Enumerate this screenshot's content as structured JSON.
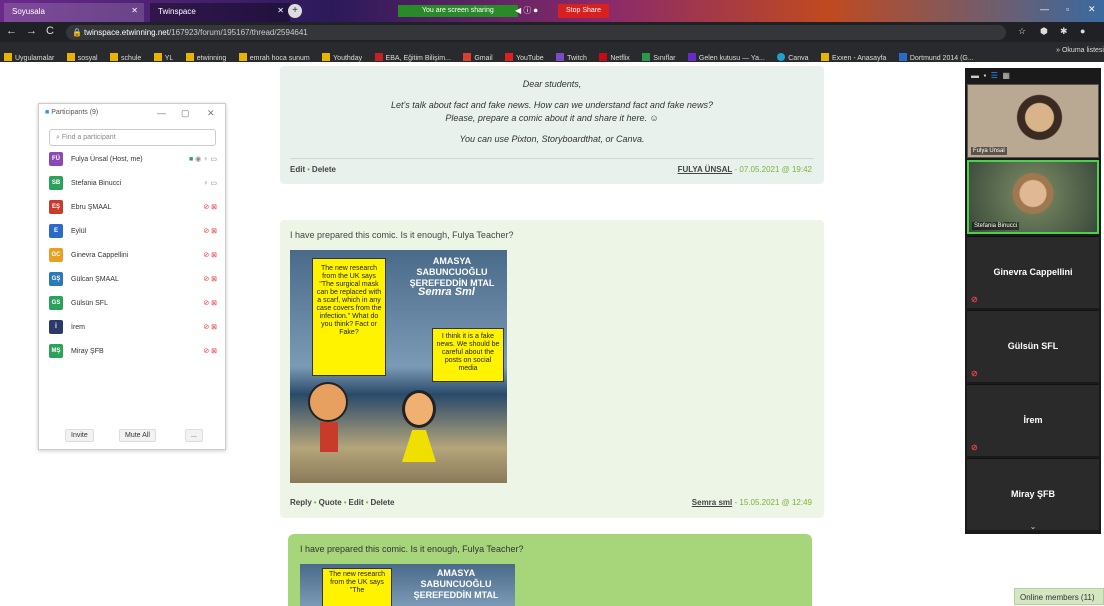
{
  "browser": {
    "tabs": [
      {
        "label": "Soyusala"
      },
      {
        "label": "Twinspace"
      }
    ],
    "new_tab": "+",
    "screen_share": {
      "label": "You are screen sharing",
      "stop_label": "Stop Share"
    },
    "url_domain": "twinspace.etwinning.net",
    "url_path": "/167923/forum/195167/thread/2594641",
    "bookmarks": [
      "Uygulamalar",
      "sosyal",
      "schule",
      "YL",
      "etwinning",
      "emrah hoca sunum",
      "Youthday",
      "EBA, Eğitim Bilişim...",
      "Gmail",
      "YouTube",
      "Twitch",
      "Netflix",
      "Sınıflar",
      "Gelen kutusu — Ya...",
      "Canva",
      "Exxen - Anasayfa",
      "Dortmund 2014 (G..."
    ],
    "bookmarks_more": "» Okuma listesi"
  },
  "post1": {
    "greeting": "Dear students,",
    "line1": "Let's talk about fact and fake news. How can we understand fact and fake news?",
    "line2": "Please, prepare a comic about it and share it here. ☺",
    "line3": "You can use Pixton, Storyboardthat, or Canva.",
    "edit": "Edit",
    "delete": "Delete",
    "author": "FULYA ÜNSAL",
    "date": "- 07.05.2021 @ 19:42"
  },
  "post2": {
    "text": "I have prepared this comic. Is it enough, Fulya Teacher?",
    "reply": "Reply",
    "quote": "Quote",
    "edit": "Edit",
    "delete": "Delete",
    "author": "Semra sml",
    "date": "- 15.05.2021 @ 12:49",
    "comic": {
      "title": "AMASYA SABUNCUOĞLU ŞEREFEDDİN MTAL",
      "signature": "Semra Sml",
      "bubble1": "The new research from the UK says \"The surgical mask can be replaced with a scarf, which in any case covers from the infection.\" What do you think? Fact or Fake?",
      "bubble2": "I think it is a fake news. We should be careful about the posts on social media"
    }
  },
  "post3": {
    "text": "I have prepared this comic. Is it enough, Fulya Teacher?",
    "comic_title": "AMASYA SABUNCUOĞLU ŞEREFEDDİN MTAL",
    "bubble": "The new research from the UK says \"The"
  },
  "zoom": {
    "title": "Participants (9)",
    "search_placeholder": "Find a participant",
    "participants": [
      {
        "initials": "FÜ",
        "name": "Fulya Ünsal (Host, me)",
        "color": "#8a4ab5",
        "muted": false
      },
      {
        "initials": "SB",
        "name": "Stefania Binucci",
        "color": "#2aa25a",
        "muted": false
      },
      {
        "initials": "EŞ",
        "name": "Ebru ŞMAAL",
        "color": "#c83a2a",
        "muted": true
      },
      {
        "initials": "E",
        "name": "Eylül",
        "color": "#2a6ac8",
        "muted": true
      },
      {
        "initials": "GC",
        "name": "Ginevra Cappellini",
        "color": "#e8a020",
        "muted": true
      },
      {
        "initials": "GŞ",
        "name": "Gülcan ŞMAAL",
        "color": "#2a7ab5",
        "muted": true
      },
      {
        "initials": "GS",
        "name": "Gülsün SFL",
        "color": "#2aa25a",
        "muted": true
      },
      {
        "initials": "İ",
        "name": "İrem",
        "color": "#2a3a6a",
        "muted": true
      },
      {
        "initials": "MŞ",
        "name": "Miray ŞFB",
        "color": "#2aa25a",
        "muted": true
      }
    ],
    "invite": "Invite",
    "mute_all": "Mute All",
    "more": "..."
  },
  "gallery": {
    "video_tiles": [
      "Fulya Ünsal",
      "Stefania Binucci"
    ],
    "name_tiles": [
      "Ginevra Cappellini",
      "Gülsün SFL",
      "İrem",
      "Miray ŞFB"
    ]
  },
  "online_members": "Online members (11)"
}
